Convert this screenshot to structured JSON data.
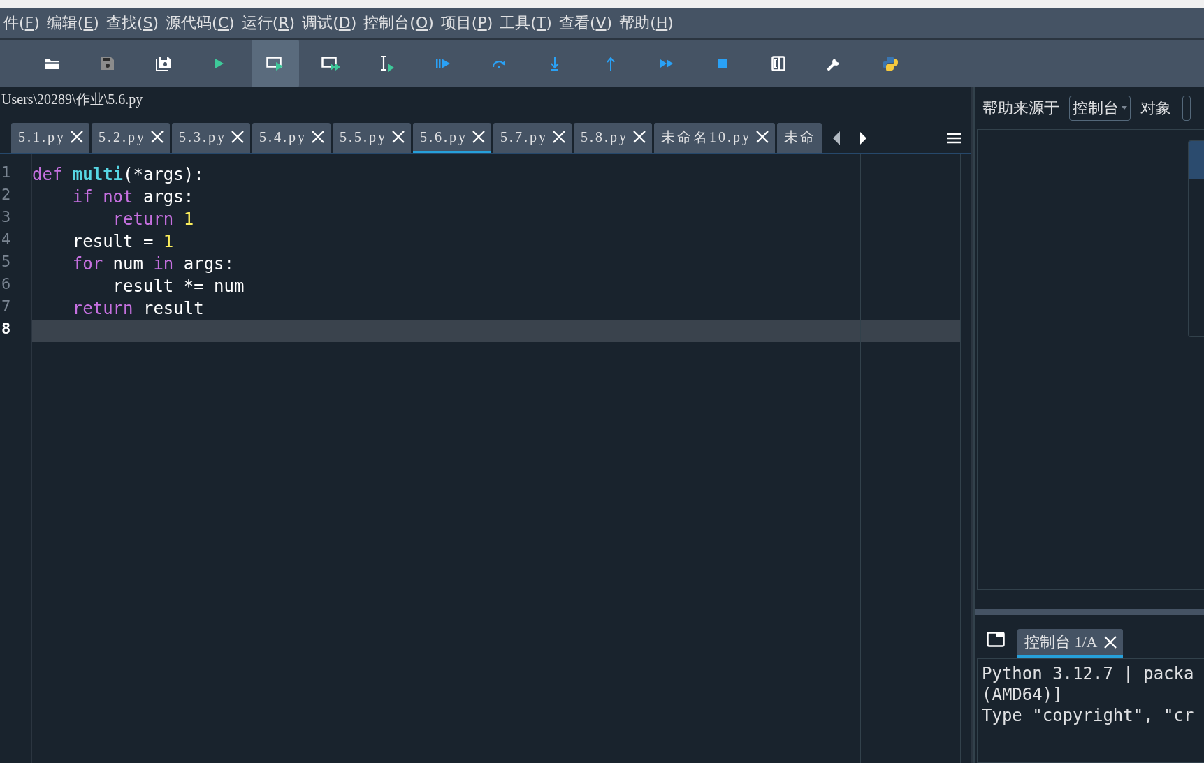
{
  "menu": [
    {
      "before": "件(",
      "key": "F",
      "after": ")"
    },
    {
      "before": "编辑(",
      "key": "E",
      "after": ")"
    },
    {
      "before": "查找(",
      "key": "S",
      "after": ")"
    },
    {
      "before": "源代码(",
      "key": "C",
      "after": ")"
    },
    {
      "before": "运行(",
      "key": "R",
      "after": ")"
    },
    {
      "before": "调试(",
      "key": "D",
      "after": ")"
    },
    {
      "before": "控制台(",
      "key": "O",
      "after": ")"
    },
    {
      "before": "项目(",
      "key": "P",
      "after": ")"
    },
    {
      "before": "工具(",
      "key": "T",
      "after": ")"
    },
    {
      "before": "查看(",
      "key": "V",
      "after": ")"
    },
    {
      "before": "帮助(",
      "key": "H",
      "after": ")"
    }
  ],
  "toolbar": [
    {
      "kind": "open",
      "selected": false,
      "disabled": false
    },
    {
      "kind": "save",
      "selected": false,
      "disabled": true
    },
    {
      "kind": "save-all",
      "selected": false,
      "disabled": false
    },
    {
      "kind": "run",
      "selected": false,
      "disabled": false
    },
    {
      "kind": "run-cell",
      "selected": true,
      "disabled": false
    },
    {
      "kind": "run-cell-advance",
      "selected": false,
      "disabled": false
    },
    {
      "kind": "run-selection",
      "selected": false,
      "disabled": false
    },
    {
      "kind": "debug",
      "selected": false,
      "disabled": false
    },
    {
      "kind": "step-over",
      "selected": false,
      "disabled": false
    },
    {
      "kind": "step-into",
      "selected": false,
      "disabled": false
    },
    {
      "kind": "step-return",
      "selected": false,
      "disabled": false
    },
    {
      "kind": "continue",
      "selected": false,
      "disabled": false
    },
    {
      "kind": "stop",
      "selected": false,
      "disabled": false
    },
    {
      "kind": "maximize",
      "selected": false,
      "disabled": false
    },
    {
      "kind": "preferences",
      "selected": false,
      "disabled": false
    },
    {
      "kind": "python",
      "selected": false,
      "disabled": false
    }
  ],
  "path": "Users\\20289\\作业\\5.6.py",
  "tabs": [
    {
      "label": "5.1.py",
      "selected": false,
      "closable": true
    },
    {
      "label": "5.2.py",
      "selected": false,
      "closable": true
    },
    {
      "label": "5.3.py",
      "selected": false,
      "closable": true
    },
    {
      "label": "5.4.py",
      "selected": false,
      "closable": true
    },
    {
      "label": "5.5.py",
      "selected": false,
      "closable": true
    },
    {
      "label": "5.6.py",
      "selected": true,
      "closable": true
    },
    {
      "label": "5.7.py",
      "selected": false,
      "closable": true
    },
    {
      "label": "5.8.py",
      "selected": false,
      "closable": true
    },
    {
      "label": "未命名10.py",
      "selected": false,
      "closable": true
    },
    {
      "label": "未命",
      "selected": false,
      "closable": false
    }
  ],
  "editor": {
    "lines": [
      {
        "number": "1",
        "current": false,
        "tokens": [
          {
            "text": "def ",
            "kind": "keyword"
          },
          {
            "text": "multi",
            "kind": "function"
          },
          {
            "text": "(*args):",
            "kind": "plain"
          }
        ]
      },
      {
        "number": "2",
        "current": false,
        "tokens": [
          {
            "text": "    if not",
            "kind": "keyword"
          },
          {
            "text": " args:",
            "kind": "plain"
          }
        ]
      },
      {
        "number": "3",
        "current": false,
        "tokens": [
          {
            "text": "        return ",
            "kind": "keyword"
          },
          {
            "text": "1",
            "kind": "number"
          }
        ]
      },
      {
        "number": "4",
        "current": false,
        "tokens": [
          {
            "text": "    result = ",
            "kind": "plain"
          },
          {
            "text": "1",
            "kind": "number"
          }
        ]
      },
      {
        "number": "5",
        "current": false,
        "tokens": [
          {
            "text": "    for",
            "kind": "keyword"
          },
          {
            "text": " num ",
            "kind": "plain"
          },
          {
            "text": "in",
            "kind": "keyword"
          },
          {
            "text": " args:",
            "kind": "plain"
          }
        ]
      },
      {
        "number": "6",
        "current": false,
        "tokens": [
          {
            "text": "        result *= num",
            "kind": "plain"
          }
        ]
      },
      {
        "number": "7",
        "current": false,
        "tokens": [
          {
            "text": "    return",
            "kind": "keyword"
          },
          {
            "text": " result",
            "kind": "plain"
          }
        ]
      },
      {
        "number": "8",
        "current": true
      }
    ]
  },
  "help": {
    "source_label": "帮助来源于",
    "source_value": "控制台",
    "object_label": "对象"
  },
  "console": {
    "tabs": [
      {
        "label": "控制台 1/A",
        "selected": true
      }
    ],
    "lines": [
      "Python 3.12.7 | packa",
      "(AMD64)]",
      "Type \"copyright\", \"cr"
    ]
  }
}
